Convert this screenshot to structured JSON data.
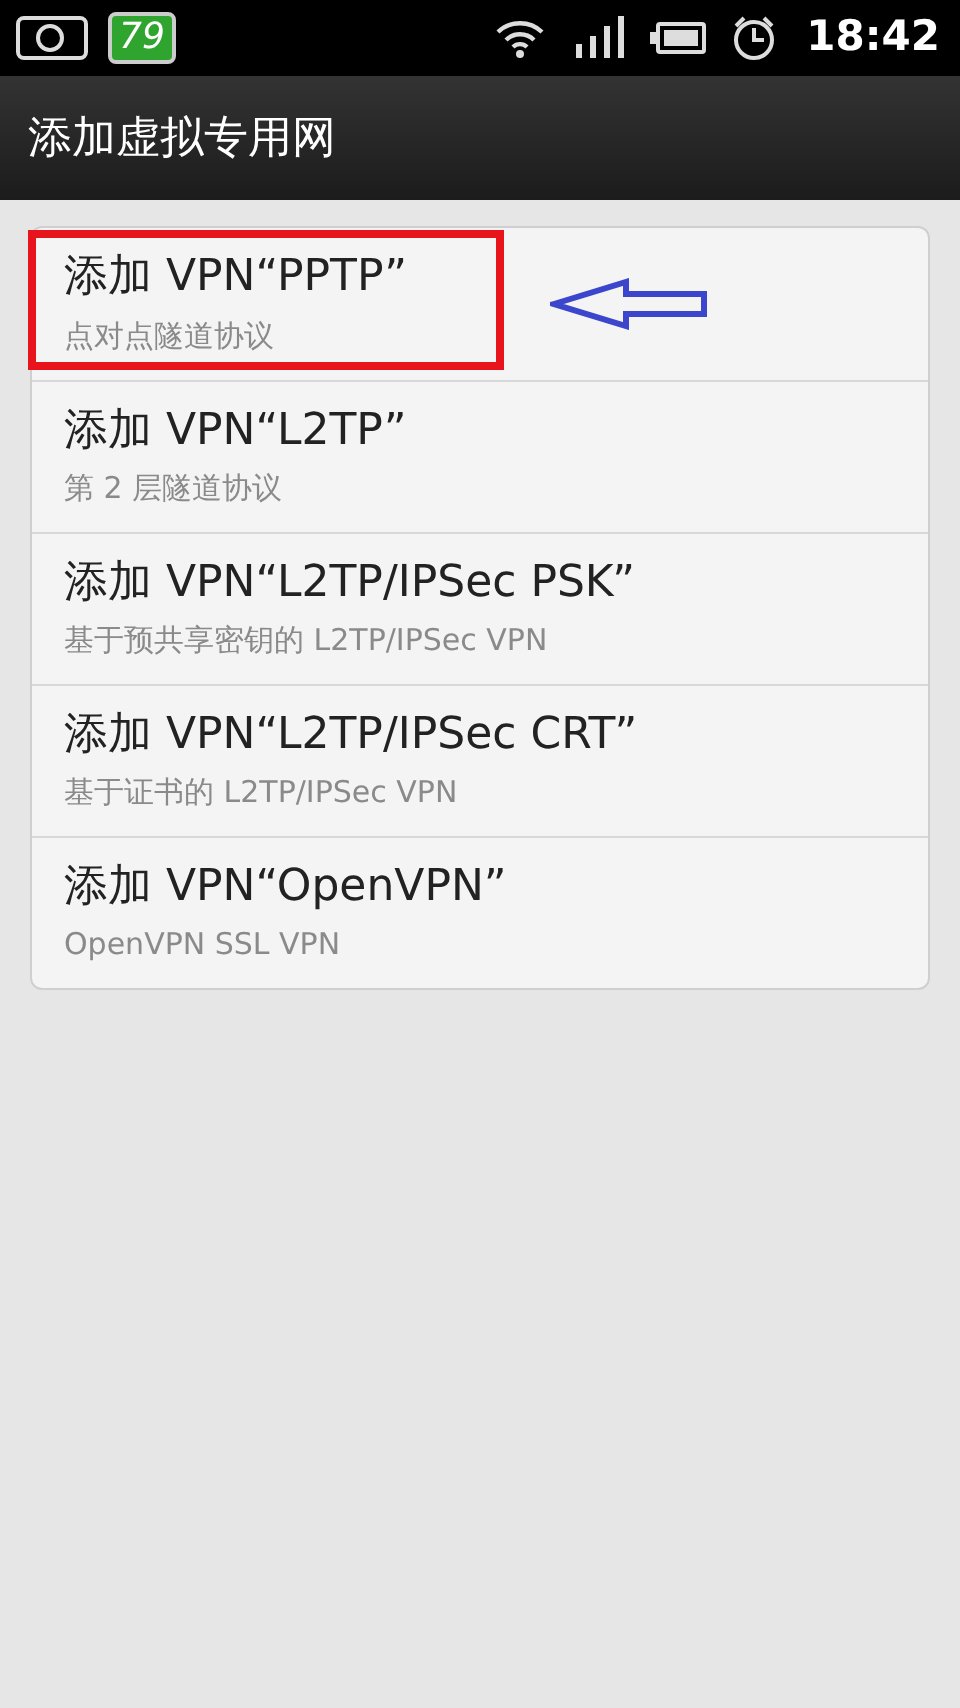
{
  "status_bar": {
    "charge_badge": "79",
    "time": "18:42"
  },
  "title": "添加虚拟专用网",
  "items": [
    {
      "title": "添加 VPN“PPTP”",
      "subtitle": "点对点隧道协议",
      "highlighted": true
    },
    {
      "title": "添加 VPN“L2TP”",
      "subtitle": "第 2 层隧道协议",
      "highlighted": false
    },
    {
      "title": "添加 VPN“L2TP/IPSec PSK”",
      "subtitle": "基于预共享密钥的 L2TP/IPSec VPN",
      "highlighted": false
    },
    {
      "title": "添加 VPN“L2TP/IPSec CRT”",
      "subtitle": "基于证书的 L2TP/IPSec VPN",
      "highlighted": false
    },
    {
      "title": "添加 VPN“OpenVPN”",
      "subtitle": "OpenVPN SSL VPN",
      "highlighted": false
    }
  ]
}
